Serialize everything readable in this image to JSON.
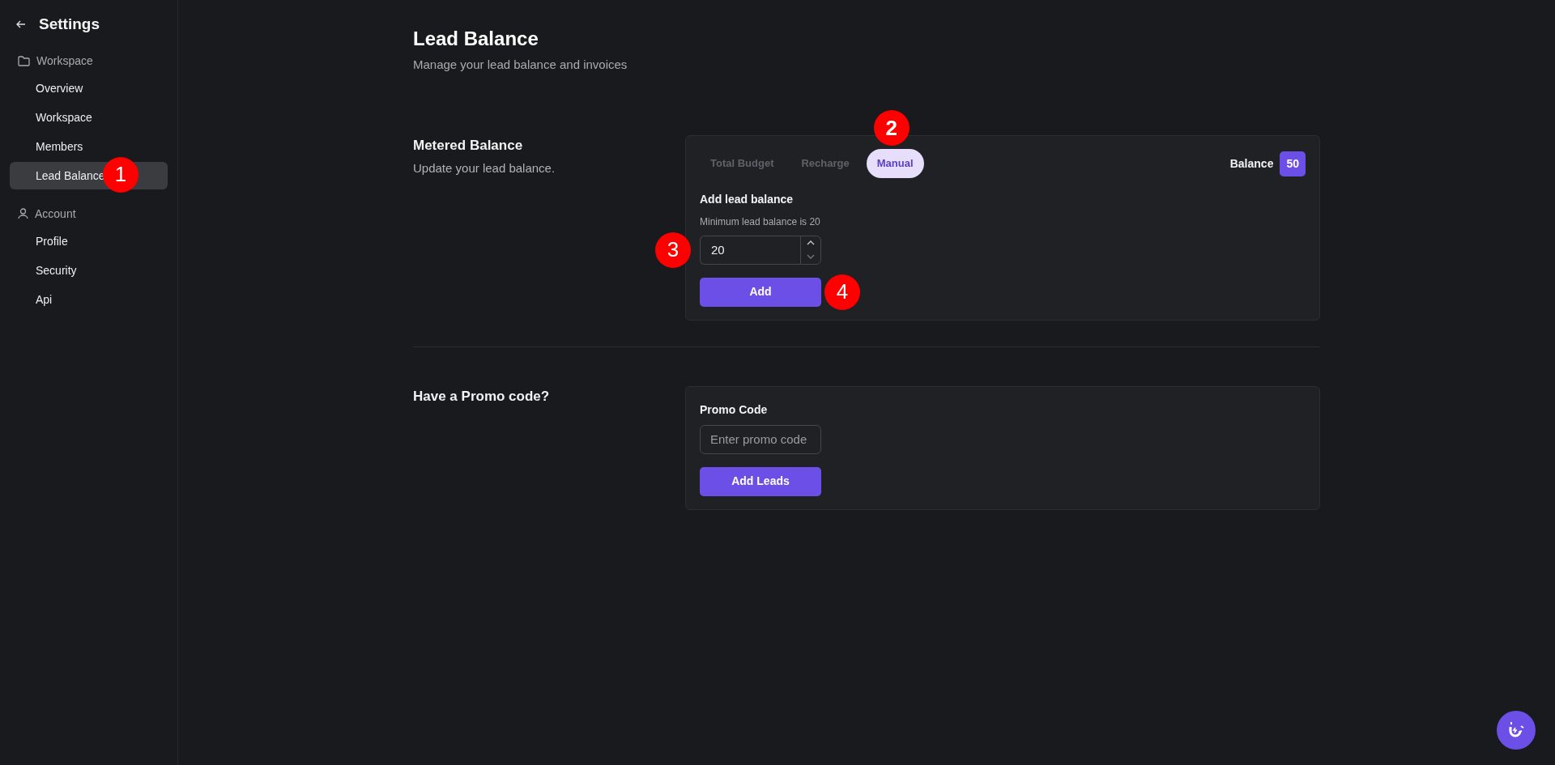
{
  "sidebar": {
    "title": "Settings",
    "groups": [
      {
        "kind": "folder",
        "label": "Workspace",
        "items": [
          {
            "label": "Overview",
            "selected": false
          },
          {
            "label": "Workspace",
            "selected": false
          },
          {
            "label": "Members",
            "selected": false
          },
          {
            "label": "Lead Balance",
            "selected": true,
            "marker": "1"
          }
        ]
      },
      {
        "kind": "person",
        "label": "Account",
        "items": [
          {
            "label": "Profile",
            "selected": false
          },
          {
            "label": "Security",
            "selected": false
          },
          {
            "label": "Api",
            "selected": false
          }
        ]
      }
    ]
  },
  "page": {
    "title": "Lead Balance",
    "subtitle": "Manage your lead balance and invoices"
  },
  "sections": [
    {
      "kind": "metered",
      "title": "Metered Balance",
      "subtitle": "Update your lead balance.",
      "tabs": [
        {
          "label": "Total Budget",
          "selected": false
        },
        {
          "label": "Recharge",
          "selected": false
        },
        {
          "label": "Manual",
          "selected": true,
          "marker": "2"
        }
      ],
      "balance_label": "Balance",
      "balance_value": "50",
      "form_title": "Add lead balance",
      "hint": "Minimum lead balance is 20",
      "amount": "20",
      "amount_marker": "3",
      "button": "Add",
      "button_marker": "4"
    },
    {
      "kind": "promo",
      "title": "Have a Promo code?",
      "field_label": "Promo Code",
      "placeholder": "Enter promo code",
      "button": "Add Leads"
    }
  ]
}
